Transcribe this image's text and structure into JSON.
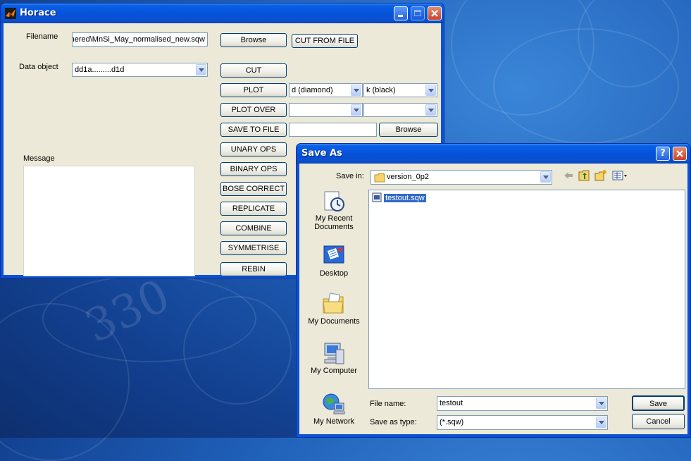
{
  "horace": {
    "title": "Horace",
    "filename_label": "Filename",
    "filename_value": "nered\\MnSi_May_normalised_new.sqw",
    "data_object_label": "Data object",
    "data_object_value": "dd1a.........d1d",
    "message_label": "Message",
    "buttons": {
      "browse": "Browse",
      "cut_from_file": "CUT FROM FILE",
      "cut": "CUT",
      "plot": "PLOT",
      "plot_over": "PLOT OVER",
      "save_to_file": "SAVE TO FILE",
      "browse2": "Browse",
      "unary_ops": "UNARY OPS",
      "binary_ops": "BINARY OPS",
      "bose_correct": "BOSE CORRECT",
      "replicate": "REPLICATE",
      "combine": "COMBINE",
      "symmetrise": "SYMMETRISE",
      "rebin": "REBIN"
    },
    "plot_marker": "d (diamond)",
    "plot_color": "k (black)",
    "plot_over_marker": "",
    "plot_over_color": "",
    "save_file_value": ""
  },
  "save_dialog": {
    "title": "Save As",
    "save_in_label": "Save in:",
    "save_in_value": "version_0p2",
    "places": [
      "My Recent Documents",
      "Desktop",
      "My Documents",
      "My Computer",
      "My Network"
    ],
    "files": [
      {
        "name": "testout.sqw"
      }
    ],
    "file_name_label": "File name:",
    "file_name_value": "testout",
    "save_as_type_label": "Save as type:",
    "save_as_type_value": "(*.sqw)",
    "save_button": "Save",
    "cancel_button": "Cancel",
    "help_glyph": "?",
    "close_glyph": "✕"
  },
  "desktop": {
    "watermark": "330"
  }
}
